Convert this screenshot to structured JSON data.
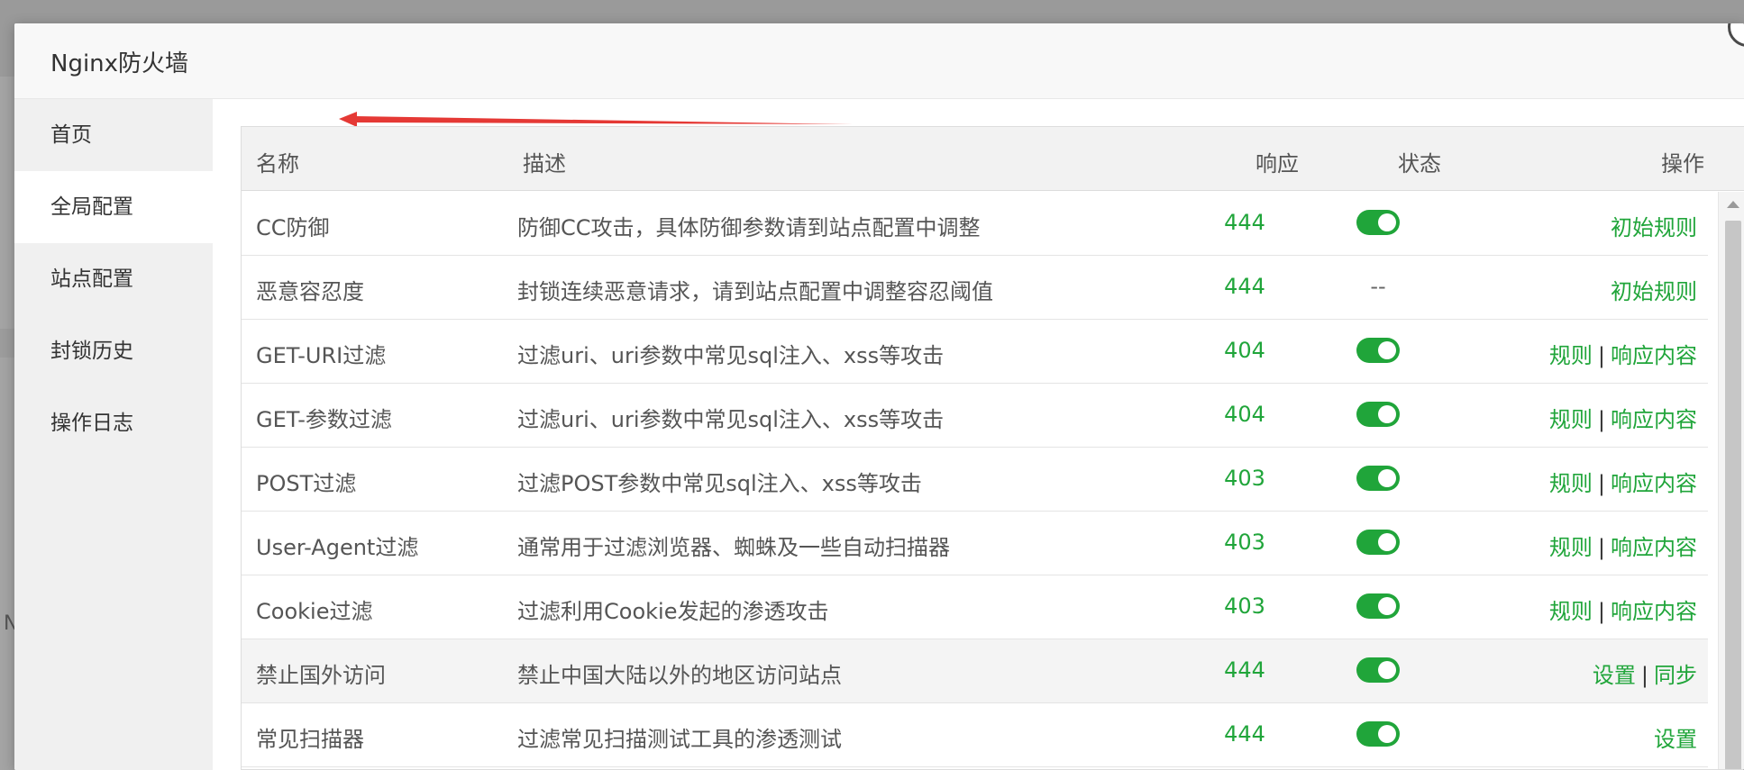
{
  "modal": {
    "title": "Nginx防火墙"
  },
  "sidebar": {
    "items": [
      {
        "label": "首页",
        "active": false
      },
      {
        "label": "全局配置",
        "active": true
      },
      {
        "label": "站点配置",
        "active": false
      },
      {
        "label": "封锁历史",
        "active": false
      },
      {
        "label": "操作日志",
        "active": false
      }
    ]
  },
  "table": {
    "headers": {
      "name": "名称",
      "desc": "描述",
      "resp": "响应",
      "status": "状态",
      "ops": "操作"
    },
    "rows": [
      {
        "name": "CC防御",
        "desc": "防御CC攻击，具体防御参数请到站点配置中调整",
        "resp": "444",
        "status": "on",
        "ops": [
          "初始规则"
        ]
      },
      {
        "name": "恶意容忍度",
        "desc": "封锁连续恶意请求，请到站点配置中调整容忍阈值",
        "resp": "444",
        "status": "--",
        "ops": [
          "初始规则"
        ]
      },
      {
        "name": "GET-URI过滤",
        "desc": "过滤uri、uri参数中常见sql注入、xss等攻击",
        "resp": "404",
        "status": "on",
        "ops": [
          "规则",
          "响应内容"
        ]
      },
      {
        "name": "GET-参数过滤",
        "desc": "过滤uri、uri参数中常见sql注入、xss等攻击",
        "resp": "404",
        "status": "on",
        "ops": [
          "规则",
          "响应内容"
        ]
      },
      {
        "name": "POST过滤",
        "desc": "过滤POST参数中常见sql注入、xss等攻击",
        "resp": "403",
        "status": "on",
        "ops": [
          "规则",
          "响应内容"
        ]
      },
      {
        "name": "User-Agent过滤",
        "desc": "通常用于过滤浏览器、蜘蛛及一些自动扫描器",
        "resp": "403",
        "status": "on",
        "ops": [
          "规则",
          "响应内容"
        ]
      },
      {
        "name": "Cookie过滤",
        "desc": "过滤利用Cookie发起的渗透攻击",
        "resp": "403",
        "status": "on",
        "ops": [
          "规则",
          "响应内容"
        ]
      },
      {
        "name": "禁止国外访问",
        "desc": "禁止中国大陆以外的地区访问站点",
        "resp": "444",
        "status": "on",
        "ops": [
          "设置",
          "同步"
        ]
      },
      {
        "name": "常见扫描器",
        "desc": "过滤常见扫描测试工具的渗透测试",
        "resp": "444",
        "status": "on",
        "ops": [
          "设置"
        ]
      }
    ]
  },
  "colors": {
    "accent": "#20a53a",
    "annotation": "#e53935"
  },
  "icons": {
    "close": "close-icon",
    "scroll_up": "scroll-up-icon",
    "annotation": "arrow-annotation"
  }
}
